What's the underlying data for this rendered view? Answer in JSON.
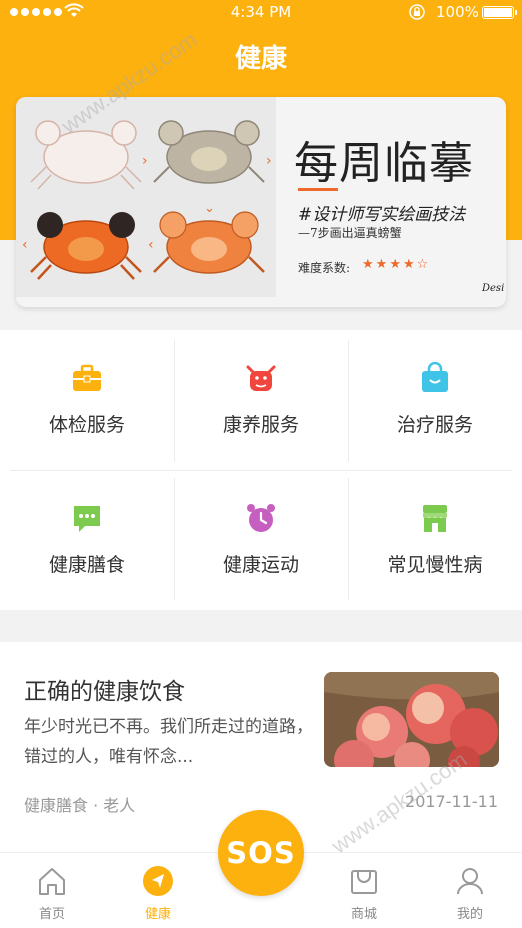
{
  "status_bar": {
    "time": "4:34 PM",
    "battery": "100%"
  },
  "header": {
    "title": "健康"
  },
  "banner": {
    "title": "每周临摹",
    "tag": "#设计师写实绘画技法",
    "subtitle": "—7步画出逼真螃蟹",
    "difficulty_label": "难度系数:",
    "rating": 4,
    "rating_max": 5,
    "signature": "Desi"
  },
  "services": [
    {
      "label": "体检服务",
      "icon": "briefcase-icon",
      "color": "#fcb10f"
    },
    {
      "label": "康养服务",
      "icon": "bull-icon",
      "color": "#f0463e"
    },
    {
      "label": "治疗服务",
      "icon": "shopping-bag-icon",
      "color": "#3fc4e8"
    },
    {
      "label": "健康膳食",
      "icon": "chat-icon",
      "color": "#7ccb4f"
    },
    {
      "label": "健康运动",
      "icon": "alarm-clock-icon",
      "color": "#c65fc0"
    },
    {
      "label": "常见慢性病",
      "icon": "store-icon",
      "color": "#7ccb4f"
    }
  ],
  "article": {
    "title": "正确的健康饮食",
    "description": "年少时光已不再。我们所走过的道路，错过的人，唯有怀念...",
    "meta": "健康膳食 · 老人",
    "date": "2017-11-11"
  },
  "tabbar": {
    "tabs": [
      {
        "label": "首页",
        "icon": "home-icon"
      },
      {
        "label": "健康",
        "icon": "navigation-icon"
      },
      {
        "label": "商城",
        "icon": "shop-icon"
      },
      {
        "label": "我的",
        "icon": "user-icon"
      }
    ],
    "active": "健康",
    "sos_label": "SOS"
  },
  "watermark": "www.apkzu.com",
  "colors": {
    "accent": "#fcb10f",
    "star": "#ee6a2b"
  }
}
